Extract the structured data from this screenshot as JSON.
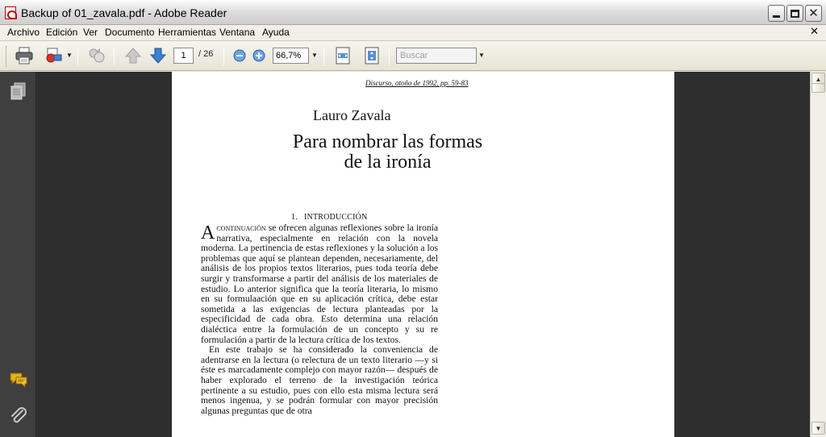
{
  "window": {
    "title": "Backup of 01_zavala.pdf - Adobe Reader"
  },
  "menu": {
    "items": [
      "Archivo",
      "Edición",
      "Ver",
      "Documento",
      "Herramientas",
      "Ventana",
      "Ayuda"
    ]
  },
  "toolbar": {
    "page_current": "1",
    "page_total": "/ 26",
    "zoom": "66,7%",
    "search_placeholder": "Buscar"
  },
  "document": {
    "running_head": "Discurso, otoño de 1992, pp. 59-83",
    "author": "Lauro Zavala",
    "title_line1": "Para nombrar las formas",
    "title_line2": "de la ironía",
    "section_number": "1.",
    "section_title": "INTRODUCCIÓN",
    "dropcap": "A",
    "para1_smallcaps": "continuación",
    "para1_rest": " se ofrecen algunas reflexiones sobre la ironía narrativa, especialmente en relación con la novela moderna. La pertinencia de estas reflexiones y la solución a los problemas que aquí se plantean dependen, necesariamente, del análisis de los propios textos literarios, pues toda teoría debe surgir y transformarse a partir del análisis de los materiales de estudio. Lo anterior significa que la teoría literaria, lo mismo en su formulaación que en su aplicación crítica, debe estar sometida a las exigencias de lectura planteadas por la especificidad de cada obra. Esto determina una relación dialéctica entre la formulación de un concepto y su re formulación a partir de la lectura crítica de los textos.",
    "para2": "En este trabajo se ha considerado la conveniencia de adentrarse en la lectura (o relectura de un texto literario —y si éste es marcadamente complejo con mayor razón— después de haber explorado el terreno de la investigación teórica pertinente a su estudio, pues con ello esta misma lectura será menos ingenua, y se podrán formular con mayor precisión algunas preguntas que de otra"
  },
  "icons": {
    "window": "pdf-icon",
    "print": "printer-icon",
    "email": "email-icon",
    "collaborate": "collaborate-icon",
    "prev": "up-arrow-icon",
    "next": "down-arrow-icon",
    "zoom_out": "zoom-out-icon",
    "zoom_in": "zoom-in-icon",
    "fit_width": "fit-width-icon",
    "fit_page": "fit-page-icon",
    "pages": "pages-icon",
    "comments": "comment-icon",
    "attachments": "paperclip-icon"
  }
}
